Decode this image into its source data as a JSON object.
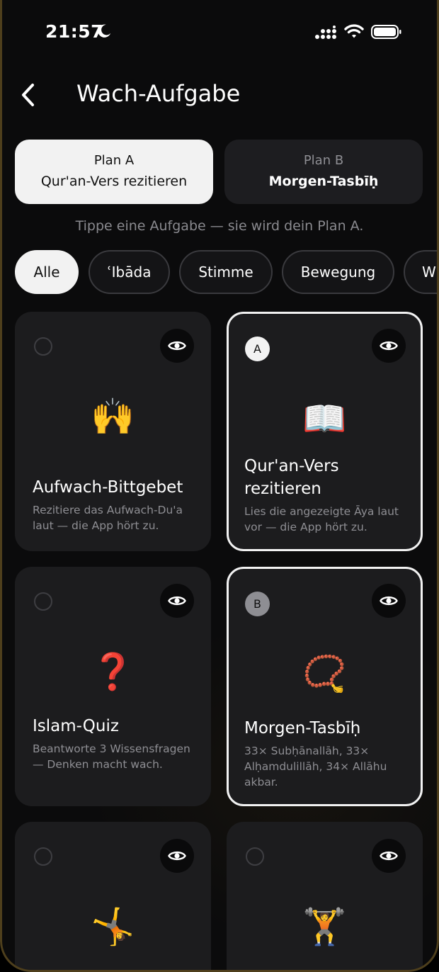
{
  "status_bar": {
    "time": "21:57",
    "icons": [
      "moon-icon",
      "signal-icon",
      "wifi-icon",
      "battery-icon"
    ]
  },
  "header": {
    "back_icon": "chevron-left-icon",
    "title": "Wach-Aufgabe"
  },
  "plans": [
    {
      "label": "Plan A",
      "task": "Qur'an-Vers rezitieren",
      "active": true
    },
    {
      "label": "Plan B",
      "task": "Morgen-Tasbīḥ",
      "active": false
    }
  ],
  "hint": "Tippe eine Aufgabe — sie wird dein Plan A.",
  "filters": [
    {
      "label": "Alle",
      "active": true
    },
    {
      "label": "ʿIbāda",
      "active": false
    },
    {
      "label": "Stimme",
      "active": false
    },
    {
      "label": "Bewegung",
      "active": false
    },
    {
      "label": "Wi",
      "active": false
    }
  ],
  "tasks": [
    {
      "title": "Aufwach-Bittgebet",
      "description": "Rezitiere das Aufwach-Du'a laut — die App hört zu.",
      "icon": "praying-hands-icon",
      "emoji": "🙌",
      "plan": ""
    },
    {
      "title": "Qur'an-Vers rezitieren",
      "description": "Lies die angezeigte Āya laut vor — die App hört zu.",
      "icon": "open-book-icon",
      "emoji": "📖",
      "plan": "A"
    },
    {
      "title": "Islam-Quiz",
      "description": "Beantworte 3 Wissensfragen — Denken macht wach.",
      "icon": "question-shield-icon",
      "emoji": "❓",
      "plan": ""
    },
    {
      "title": "Morgen-Tasbīḥ",
      "description": "33× Subḥānallāh, 33× Alḥamdulillāh, 34× Allāhu akbar.",
      "icon": "prayer-beads-icon",
      "emoji": "📿",
      "plan": "B"
    },
    {
      "title": "",
      "description": "",
      "icon": "push-up-person-icon",
      "emoji": "🤸",
      "plan": ""
    },
    {
      "title": "",
      "description": "",
      "icon": "squatting-person-icon",
      "emoji": "🏋",
      "plan": ""
    }
  ],
  "preview_icon": "eye-icon",
  "colors": {
    "background": "#0b0b0c",
    "card": "#1c1c1e",
    "selected_border": "#f2f2f2",
    "muted_text": "#8e8e93",
    "frame_gold": "#4e3f1c"
  }
}
